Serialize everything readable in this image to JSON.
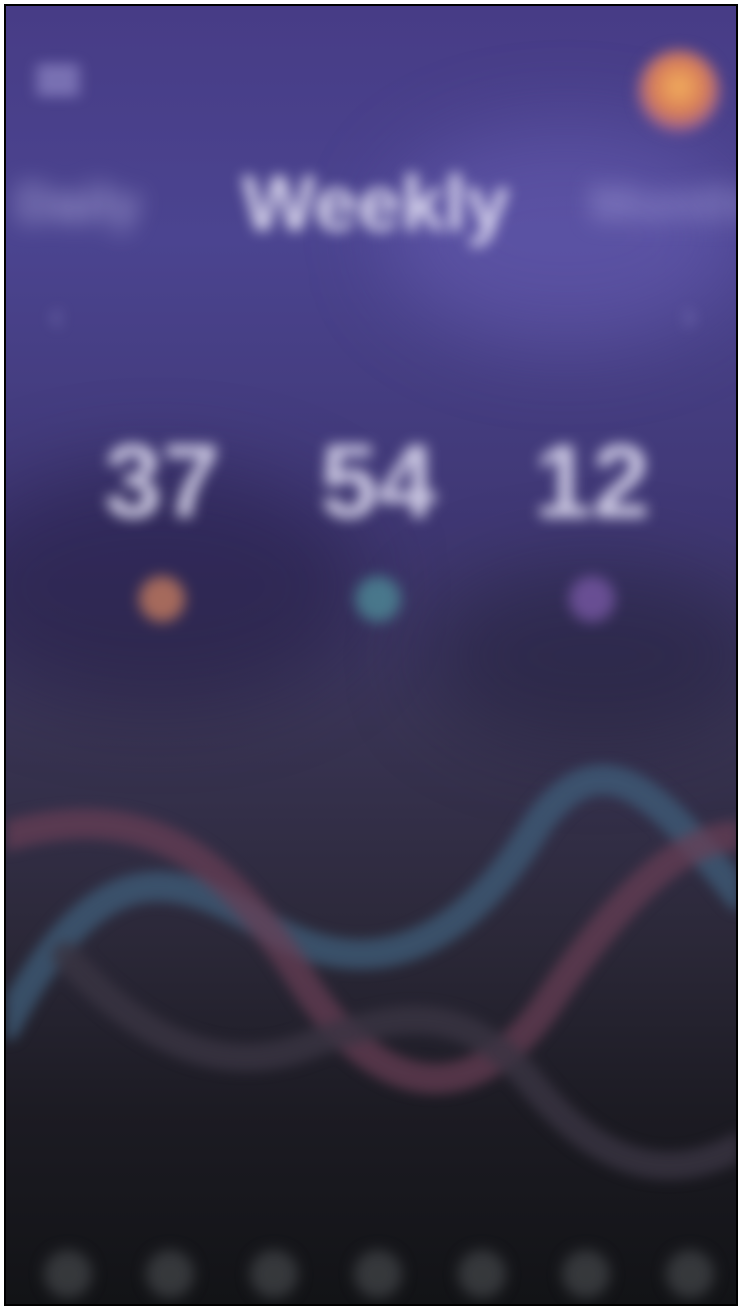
{
  "header": {
    "menu_icon": "hamburger-menu-icon",
    "avatar": "user-avatar"
  },
  "tabs": {
    "previous": "Daily",
    "active": "Weekly",
    "next": "Monthly"
  },
  "date_nav": {
    "label": "",
    "prev_icon": "chevron-left-icon",
    "next_icon": "chevron-right-icon"
  },
  "stats": [
    {
      "value": "37",
      "label": "",
      "color": "#d88660"
    },
    {
      "value": "54",
      "label": "",
      "color": "#4f8f9a"
    },
    {
      "value": "12",
      "label": "",
      "color": "#7b5aa8"
    }
  ],
  "chart": {
    "wave_colors": [
      "#3f5d7a",
      "#6a3f55"
    ]
  },
  "bottom_nav": {
    "items": [
      "nav-item-1",
      "nav-item-2",
      "nav-item-3",
      "nav-item-4",
      "nav-item-5",
      "nav-item-6",
      "nav-item-7"
    ]
  }
}
